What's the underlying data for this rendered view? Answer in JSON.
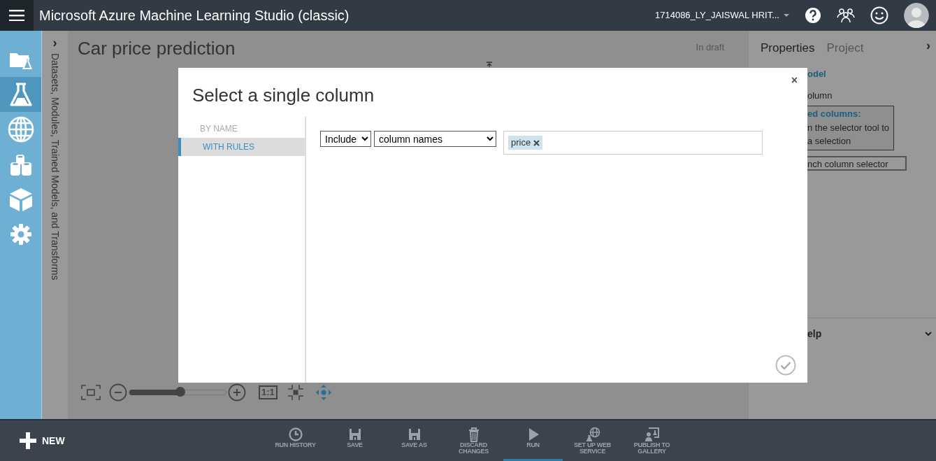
{
  "header": {
    "title": "Microsoft Azure Machine Learning Studio (classic)",
    "account": "1714086_LY_JAISWAL HRIT..."
  },
  "nav_items": [
    {
      "selected": false
    },
    {
      "selected": true
    },
    {
      "selected": false
    },
    {
      "selected": false
    },
    {
      "selected": false
    },
    {
      "selected": false
    }
  ],
  "palette": {
    "label": "Datasets, Modules, Trained Models, and Transforms",
    "expand": "›"
  },
  "canvas": {
    "title": "Car price prediction",
    "status": "In draft",
    "zoom": {
      "level": 0.53,
      "actual_size": "1:1"
    }
  },
  "properties_panel": {
    "tabs": [
      {
        "label": "Properties",
        "selected": true
      },
      {
        "label": "Project",
        "selected": false
      }
    ],
    "collapse": "›",
    "module_name": "odel",
    "field_label": "olumn",
    "selected_columns_label": "ed columns:",
    "selected_columns_hint": [
      "n the selector tool to",
      "a selection"
    ],
    "launch_button": "nch column selector",
    "help": "elp"
  },
  "dialog": {
    "title": "Select a single column",
    "close": "×",
    "modes": [
      {
        "label": "BY NAME",
        "selected": false
      },
      {
        "label": "WITH RULES",
        "selected": true
      }
    ],
    "rule": {
      "include": "Include",
      "by": "column names",
      "tags": [
        "price"
      ]
    }
  },
  "toolbar": {
    "new": "NEW",
    "items": [
      {
        "label": "RUN HISTORY",
        "selected": false
      },
      {
        "label": "SAVE",
        "selected": false
      },
      {
        "label": "SAVE AS",
        "selected": false
      },
      {
        "label": "DISCARD CHANGES",
        "selected": false
      },
      {
        "label": "RUN",
        "selected": true
      },
      {
        "label": "SET UP WEB SERVICE",
        "selected": false
      },
      {
        "label": "PUBLISH TO GALLERY",
        "selected": false
      }
    ]
  }
}
